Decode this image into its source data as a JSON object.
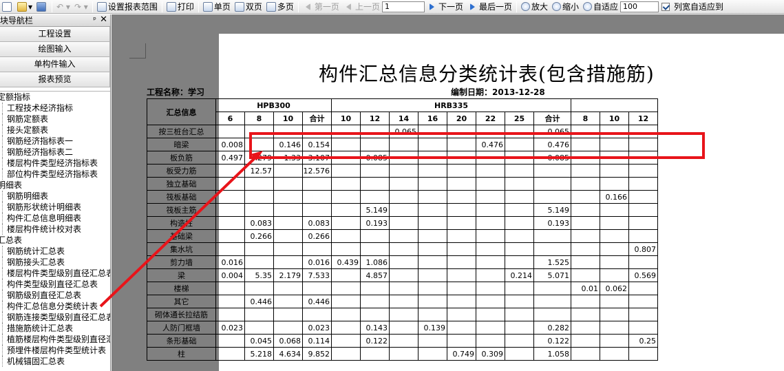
{
  "toolbar": {
    "set_range": "设置报表范围",
    "print": "打印",
    "single": "单页",
    "double": "双页",
    "multi": "多页",
    "first": "第一页",
    "prev": "上一页",
    "page_value": "1",
    "next": "下一页",
    "last": "最后一页",
    "zoom_in": "放大",
    "zoom_out": "缩小",
    "fit": "自适应",
    "zoom_value": "100",
    "col_fit": "列宽自适应到"
  },
  "sidebar": {
    "title": "模块导航栏",
    "pin": "ᵖ",
    "close": "✕",
    "buttons": [
      "工程设置",
      "绘图输入",
      "单构件输入",
      "报表预览"
    ],
    "tree": [
      {
        "type": "cat",
        "label": "定额指标"
      },
      {
        "type": "item",
        "label": "工程技术经济指标"
      },
      {
        "type": "item",
        "label": "钢筋定额表"
      },
      {
        "type": "item",
        "label": "接头定额表"
      },
      {
        "type": "item",
        "label": "钢筋经济指标表一"
      },
      {
        "type": "item",
        "label": "钢筋经济指标表二"
      },
      {
        "type": "item",
        "label": "楼层构件类型经济指标表"
      },
      {
        "type": "item",
        "label": "部位构件类型经济指标表"
      },
      {
        "type": "cat",
        "label": "明细表"
      },
      {
        "type": "item",
        "label": "钢筋明细表"
      },
      {
        "type": "item",
        "label": "钢筋形状统计明细表"
      },
      {
        "type": "item",
        "label": "构件汇总信息明细表"
      },
      {
        "type": "item",
        "label": "楼层构件统计校对表"
      },
      {
        "type": "cat",
        "label": "汇总表"
      },
      {
        "type": "item",
        "label": "钢筋统计汇总表"
      },
      {
        "type": "item",
        "label": "钢筋接头汇总表"
      },
      {
        "type": "item",
        "label": "楼层构件类型级别直径汇总表"
      },
      {
        "type": "item",
        "label": "构件类型级别直径汇总表"
      },
      {
        "type": "item",
        "label": "钢筋级别直径汇总表"
      },
      {
        "type": "item",
        "label": "构件汇总信息分类统计表"
      },
      {
        "type": "item",
        "label": "钢筋连接类型级别直径汇总表"
      },
      {
        "type": "item",
        "label": "措施筋统计汇总表"
      },
      {
        "type": "item",
        "label": "植筋楼层构件类型级别直径汇总表"
      },
      {
        "type": "item",
        "label": "预埋件楼层构件类型统计表"
      },
      {
        "type": "item",
        "label": "机械锚固汇总表"
      }
    ]
  },
  "report": {
    "title": "构件汇总信息分类统计表(包含措施筋)",
    "project": "工程名称：学习",
    "date": "编制日期：2013-12-28",
    "col_info": "汇总信息",
    "grp1": "HPB300",
    "grp2": "HRB335",
    "sub1": [
      "6",
      "8",
      "10",
      "合计"
    ],
    "sub2": [
      "10",
      "12",
      "14",
      "16",
      "20",
      "22",
      "25",
      "合计"
    ],
    "sub3": [
      "8",
      "10",
      "12"
    ],
    "rows": [
      {
        "name": "按三桩台汇总",
        "v": [
          "",
          "",
          "",
          "",
          "",
          "",
          "0.065",
          "",
          "",
          "",
          "",
          "0.065",
          "",
          "",
          ""
        ]
      },
      {
        "name": "暗梁",
        "v": [
          "0.008",
          "",
          "0.146",
          "0.154",
          "",
          "",
          "",
          "",
          "",
          "0.476",
          "",
          "0.476",
          "",
          "",
          ""
        ]
      },
      {
        "name": "板负筋",
        "v": [
          "0.497",
          "1.279",
          "1.33",
          "3.107",
          "",
          "0.085",
          "",
          "",
          "",
          "",
          "",
          "0.085",
          "",
          "",
          ""
        ]
      },
      {
        "name": "板受力筋",
        "v": [
          "",
          "12.57",
          "",
          "12.576",
          "",
          "",
          "",
          "",
          "",
          "",
          "",
          "",
          "",
          "",
          ""
        ]
      },
      {
        "name": "独立基础",
        "v": [
          "",
          "",
          "",
          "",
          "",
          "",
          "",
          "",
          "",
          "",
          "",
          "",
          "",
          "",
          ""
        ]
      },
      {
        "name": "筏板基础",
        "v": [
          "",
          "",
          "",
          "",
          "",
          "",
          "",
          "",
          "",
          "",
          "",
          "",
          "",
          "0.166",
          ""
        ]
      },
      {
        "name": "筏板主筋",
        "v": [
          "",
          "",
          "",
          "",
          "",
          "5.149",
          "",
          "",
          "",
          "",
          "",
          "5.149",
          "",
          "",
          ""
        ]
      },
      {
        "name": "构造柱",
        "v": [
          "",
          "0.083",
          "",
          "0.083",
          "",
          "0.193",
          "",
          "",
          "",
          "",
          "",
          "0.193",
          "",
          "",
          ""
        ]
      },
      {
        "name": "基础梁",
        "v": [
          "",
          "0.266",
          "",
          "0.266",
          "",
          "",
          "",
          "",
          "",
          "",
          "",
          "",
          "",
          "",
          ""
        ]
      },
      {
        "name": "集水坑",
        "v": [
          "",
          "",
          "",
          "",
          "",
          "",
          "",
          "",
          "",
          "",
          "",
          "",
          "",
          "",
          "0.807"
        ]
      },
      {
        "name": "剪力墙",
        "v": [
          "0.016",
          "",
          "",
          "0.016",
          "0.439",
          "1.086",
          "",
          "",
          "",
          "",
          "",
          "1.525",
          "",
          "",
          ""
        ]
      },
      {
        "name": "梁",
        "v": [
          "0.004",
          "5.35",
          "2.179",
          "7.533",
          "",
          "4.857",
          "",
          "",
          "",
          "",
          "0.214",
          "5.071",
          "",
          "",
          "0.569"
        ]
      },
      {
        "name": "楼梯",
        "v": [
          "",
          "",
          "",
          "",
          "",
          "",
          "",
          "",
          "",
          "",
          "",
          "",
          "0.01",
          "0.062",
          ""
        ]
      },
      {
        "name": "其它",
        "v": [
          "",
          "0.446",
          "",
          "0.446",
          "",
          "",
          "",
          "",
          "",
          "",
          "",
          "",
          "",
          "",
          ""
        ]
      },
      {
        "name": "砌体通长拉结筋",
        "v": [
          "",
          "",
          "",
          "",
          "",
          "",
          "",
          "",
          "",
          "",
          "",
          "",
          "",
          "",
          ""
        ]
      },
      {
        "name": "人防门框墙",
        "v": [
          "0.023",
          "",
          "",
          "0.023",
          "",
          "0.143",
          "",
          "0.139",
          "",
          "",
          "",
          "0.282",
          "",
          "",
          ""
        ]
      },
      {
        "name": "条形基础",
        "v": [
          "",
          "0.045",
          "0.068",
          "0.114",
          "",
          "0.122",
          "",
          "",
          "",
          "",
          "",
          "0.122",
          "",
          "",
          "0.25"
        ]
      },
      {
        "name": "柱",
        "v": [
          "",
          "5.218",
          "4.634",
          "9.852",
          "",
          "",
          "",
          "",
          "0.749",
          "0.309",
          "",
          "1.058",
          "",
          "",
          ""
        ]
      }
    ]
  },
  "annotation": {
    "color": "#e8141a"
  }
}
